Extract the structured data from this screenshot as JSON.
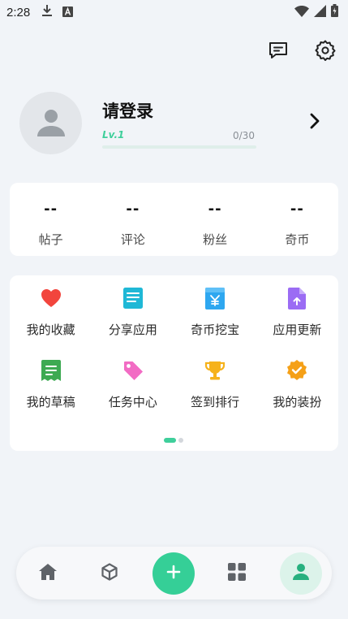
{
  "status_bar": {
    "time": "2:28"
  },
  "profile": {
    "login_title": "请登录",
    "level_label": "Lv.1",
    "level_progress_text": "0/30",
    "level_progress_fraction": 0
  },
  "stats": [
    {
      "value": "--",
      "label": "帖子"
    },
    {
      "value": "--",
      "label": "评论"
    },
    {
      "value": "--",
      "label": "粉丝"
    },
    {
      "value": "--",
      "label": "奇币"
    }
  ],
  "menu": [
    {
      "label": "我的收藏",
      "icon": "heart-icon",
      "color": "#f2453d"
    },
    {
      "label": "分享应用",
      "icon": "share-doc-icon",
      "color": "#1fb8d6"
    },
    {
      "label": "奇币挖宝",
      "icon": "yuan-coin-icon",
      "color": "#2ea7f0"
    },
    {
      "label": "应用更新",
      "icon": "update-file-icon",
      "color": "#9b6cf4"
    },
    {
      "label": "我的草稿",
      "icon": "draft-icon",
      "color": "#3daa52"
    },
    {
      "label": "任务中心",
      "icon": "tag-icon",
      "color": "#f26cc4"
    },
    {
      "label": "签到排行",
      "icon": "trophy-icon",
      "color": "#f6b21b"
    },
    {
      "label": "我的装扮",
      "icon": "badge-check-icon",
      "color": "#f5a017"
    }
  ],
  "colors": {
    "accent": "#3fcf9b",
    "background": "#f1f4f8"
  }
}
